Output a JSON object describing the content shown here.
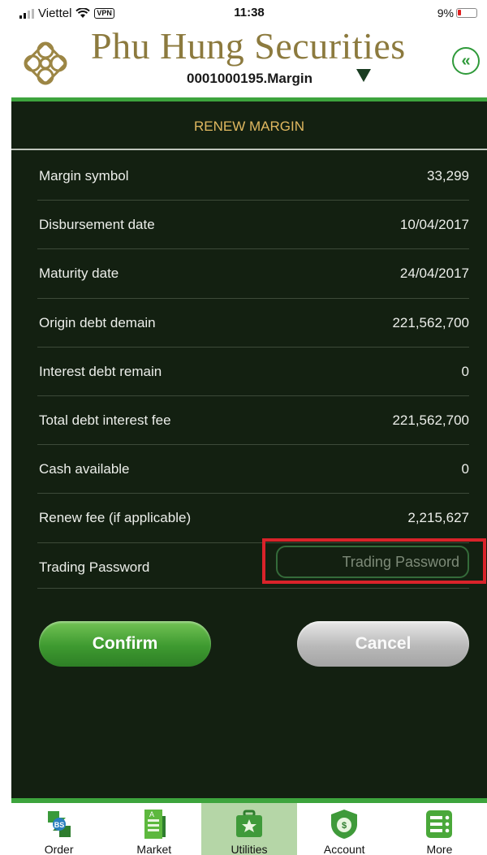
{
  "status": {
    "carrier": "Viettel",
    "vpn": "VPN",
    "time": "11:38",
    "battery": "9%"
  },
  "header": {
    "brand": "Phu Hung Securities",
    "account": "0001000195.Margin",
    "back_icon": "double-chevron-left-icon",
    "colors": {
      "brand": "#8c7a3e",
      "accent": "#3da43d"
    }
  },
  "page": {
    "title": "RENEW MARGIN"
  },
  "rows": [
    {
      "label": "Margin symbol",
      "value": "33,299"
    },
    {
      "label": "Disbursement date",
      "value": "10/04/2017"
    },
    {
      "label": "Maturity date",
      "value": "24/04/2017"
    },
    {
      "label": "Origin debt demain",
      "value": "221,562,700"
    },
    {
      "label": "Interest debt remain",
      "value": "0"
    },
    {
      "label": "Total debt interest fee",
      "value": "221,562,700"
    },
    {
      "label": "Cash available",
      "value": "0"
    },
    {
      "label": "Renew fee (if applicable)",
      "value": "2,215,627"
    }
  ],
  "password": {
    "label": "Trading Password",
    "placeholder": "Trading Password"
  },
  "buttons": {
    "confirm": "Confirm",
    "cancel": "Cancel"
  },
  "tabs": [
    {
      "label": "Order",
      "icon": "order-icon"
    },
    {
      "label": "Market",
      "icon": "market-icon"
    },
    {
      "label": "Utilities",
      "icon": "utilities-icon",
      "active": true
    },
    {
      "label": "Account",
      "icon": "account-icon"
    },
    {
      "label": "More",
      "icon": "more-icon"
    }
  ]
}
